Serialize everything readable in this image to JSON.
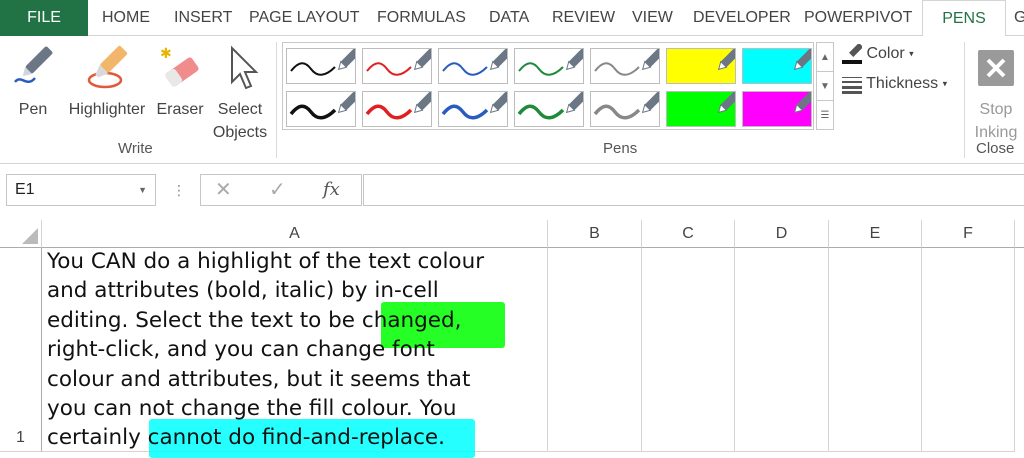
{
  "tabs": {
    "file": "FILE",
    "home": "HOME",
    "insert": "INSERT",
    "page_layout": "PAGE LAYOUT",
    "formulas": "FORMULAS",
    "data": "DATA",
    "review": "REVIEW",
    "view": "VIEW",
    "developer": "DEVELOPER",
    "powerpivot": "POWERPIVOT",
    "pens": "PENS",
    "overflow": "G"
  },
  "ribbon": {
    "write_group": {
      "label": "Write",
      "pen": "Pen",
      "highlighter": "Highlighter",
      "eraser": "Eraser",
      "select_objects_line1": "Select",
      "select_objects_line2": "Objects"
    },
    "pens_group": {
      "label": "Pens",
      "swatches_row1": [
        {
          "kind": "pen",
          "color": "#111111"
        },
        {
          "kind": "pen",
          "color": "#e02020"
        },
        {
          "kind": "pen",
          "color": "#2a5cbf"
        },
        {
          "kind": "pen",
          "color": "#1e8a3a"
        },
        {
          "kind": "pen",
          "color": "#888888"
        },
        {
          "kind": "highlighter",
          "color": "#ffff00"
        },
        {
          "kind": "highlighter",
          "color": "#00ffff"
        }
      ],
      "swatches_row2": [
        {
          "kind": "pen",
          "color": "#111111"
        },
        {
          "kind": "pen",
          "color": "#e02020"
        },
        {
          "kind": "pen",
          "color": "#2a5cbf"
        },
        {
          "kind": "pen",
          "color": "#1e8a3a"
        },
        {
          "kind": "pen",
          "color": "#888888"
        },
        {
          "kind": "highlighter",
          "color": "#00ff00"
        },
        {
          "kind": "highlighter",
          "color": "#ff00ff"
        }
      ],
      "color_label": "Color",
      "thickness_label": "Thickness"
    },
    "close_group": {
      "label": "Close",
      "stop_inking_line1": "Stop",
      "stop_inking_line2": "Inking"
    }
  },
  "formula_bar": {
    "name_box": "E1",
    "fx": "fx",
    "formula": ""
  },
  "grid": {
    "columns": [
      "A",
      "B",
      "C",
      "D",
      "E",
      "F"
    ],
    "row_number": "1",
    "cell_a1_lines": [
      "You CAN do a highlight of the text colour",
      "and attributes (bold, italic) by in-cell",
      "editing. Select the text to be changed,",
      "right-click, and you can change font",
      "colour and attributes, but it seems that",
      "you can not change the fill colour. You",
      "certainly cannot do find-and-replace."
    ]
  },
  "colors": {
    "file_tab": "#217346",
    "active_tab_text": "#217346",
    "ink_green": "#00ff00",
    "ink_cyan": "#00ffff"
  }
}
